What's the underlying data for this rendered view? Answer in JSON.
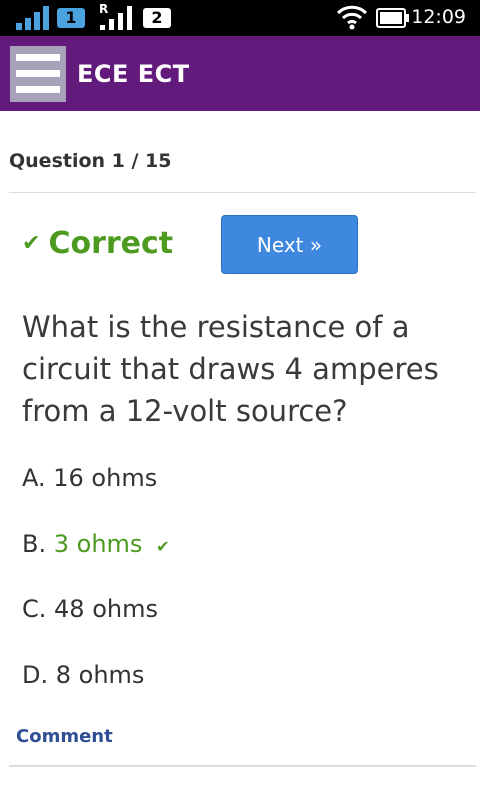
{
  "status_bar": {
    "sim1": "1",
    "sim2": "2",
    "roaming": "R",
    "time": "12:09"
  },
  "app_bar": {
    "title": "ECE ECT",
    "menu_icon": "hamburger-menu-icon"
  },
  "quiz": {
    "counter": "Question 1 / 15",
    "result_label": "Correct",
    "next_label": "Next »",
    "question": "What is the resistance of a circuit that draws 4 amperes from a 12-volt source?",
    "options": [
      {
        "prefix": "A.",
        "text": "16 ohms",
        "correct": false
      },
      {
        "prefix": "B.",
        "text": "3 ohms",
        "correct": true
      },
      {
        "prefix": "C.",
        "text": "48 ohms",
        "correct": false
      },
      {
        "prefix": "D.",
        "text": "8 ohms",
        "correct": false
      }
    ],
    "comment_label": "Comment"
  },
  "colors": {
    "app_bar": "#621b7c",
    "correct": "#4c9a1f",
    "next_button": "#3f88e0",
    "link": "#2f4f94"
  }
}
